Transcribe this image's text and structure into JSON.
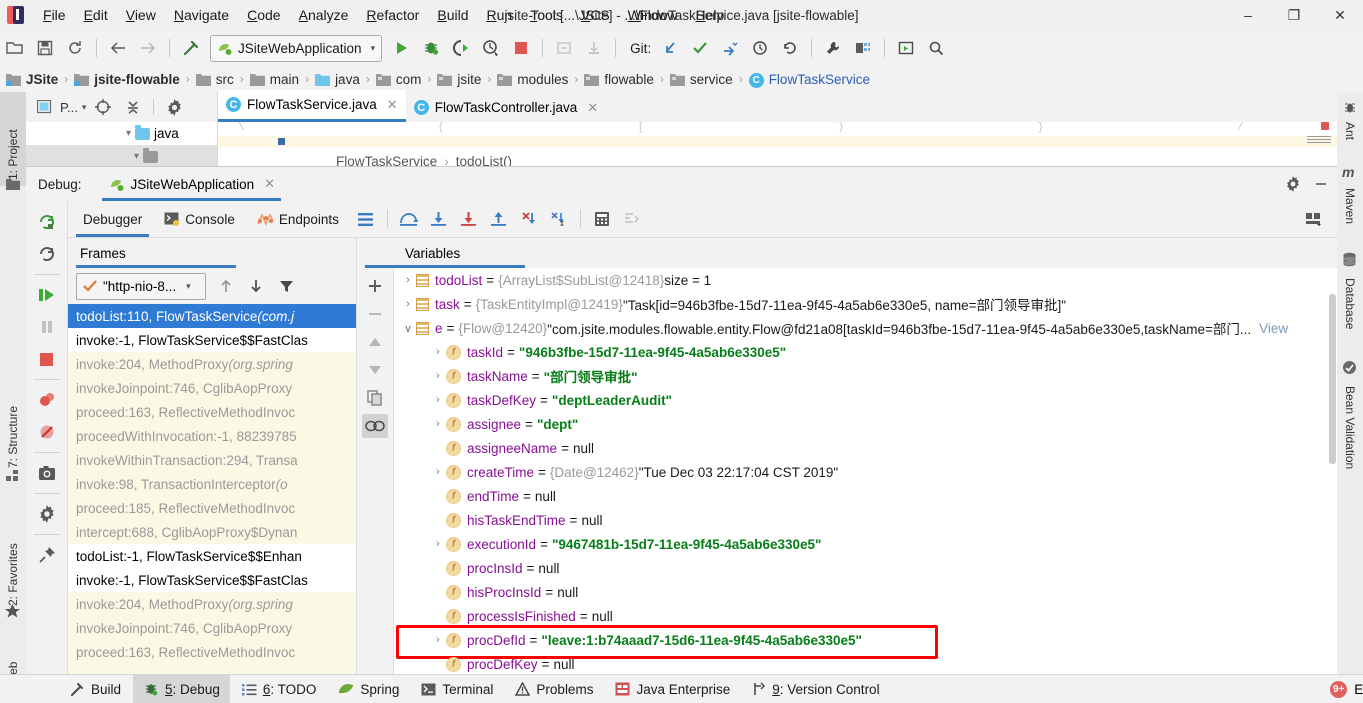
{
  "window": {
    "title": "jsite-root [...\\JSite] - ...\\FlowTaskService.java [jsite-flowable]",
    "minimize": "–",
    "maximize": "❐",
    "close": "✕"
  },
  "menu": {
    "items": [
      "File",
      "Edit",
      "View",
      "Navigate",
      "Code",
      "Analyze",
      "Refactor",
      "Build",
      "Run",
      "Tools",
      "VCS",
      "Window",
      "Help"
    ]
  },
  "toolbar": {
    "run_config": "JSiteWebApplication",
    "git_label": "Git:",
    "icons": [
      "open-folder-icon",
      "save-all-icon",
      "sync-icon",
      "back-arrow-icon",
      "forward-arrow-icon",
      "build-hammer-icon",
      "run-icon",
      "debug-icon",
      "run-with-coverage-icon",
      "profile-icon",
      "stop-icon",
      "attach-icon",
      "update-project-icon"
    ]
  },
  "breadcrumb": {
    "items": [
      {
        "label": "JSite",
        "style": "bold"
      },
      {
        "label": "jsite-flowable",
        "style": "bold"
      },
      {
        "label": "src",
        "style": "plain"
      },
      {
        "label": "main",
        "style": "plain"
      },
      {
        "label": "java",
        "style": "plain"
      },
      {
        "label": "com",
        "style": "plain"
      },
      {
        "label": "jsite",
        "style": "plain"
      },
      {
        "label": "modules",
        "style": "plain"
      },
      {
        "label": "flowable",
        "style": "plain"
      },
      {
        "label": "service",
        "style": "plain"
      },
      {
        "label": "FlowTaskService",
        "style": "class"
      }
    ],
    "separator": "›"
  },
  "left_strip": {
    "items": [
      {
        "label": "1: Project",
        "selected": true
      },
      {
        "label": "7: Structure",
        "selected": false
      },
      {
        "label": "2: Favorites",
        "selected": false
      },
      {
        "label": "Web",
        "selected": false
      }
    ]
  },
  "right_strip": {
    "items": [
      {
        "label": "Ant"
      },
      {
        "label": "Maven"
      },
      {
        "label": "Database"
      },
      {
        "label": "Bean Validation"
      }
    ]
  },
  "editor": {
    "tabs": [
      {
        "label": "FlowTaskService.java",
        "active": true
      },
      {
        "label": "FlowTaskController.java",
        "active": false
      }
    ],
    "close_glyph": "✕",
    "breadcrumb": "FlowTaskService",
    "breadcrumb_method": "todoList()",
    "breadcrumb_sep": "›",
    "tree_node": "java"
  },
  "debug_window": {
    "label": "Debug:",
    "session_tab": "JSiteWebApplication",
    "close_glyph": "✕",
    "settings_icon": "gear-icon",
    "hide_icon": "minimize-icon",
    "tabs": [
      {
        "label": "Debugger",
        "icon": "debugger-icon",
        "active": true
      },
      {
        "label": "Console",
        "icon": "console-icon",
        "active": false
      },
      {
        "label": "Endpoints",
        "icon": "endpoints-icon",
        "active": false
      }
    ],
    "toolbar_icons": [
      "layout-settings-icon",
      "step-over-icon",
      "step-into-icon",
      "force-step-into-icon",
      "step-out-icon",
      "drop-frame-icon",
      "run-to-cursor-icon",
      "evaluate-expression-icon",
      "mute-breakpoints-icon",
      "restore-layout-icon"
    ],
    "side_icons": [
      "rerun-icon",
      "restart-icon",
      "resume-program-icon",
      "pause-program-icon",
      "stop-icon",
      "view-breakpoints-icon",
      "mute-breakpoints-icon",
      "screenshot-icon",
      "settings-icon",
      "pin-tab-icon"
    ]
  },
  "frames": {
    "title": "Frames",
    "thread": "\"http-nio-8...",
    "thread_chevron": "∨",
    "tools": [
      "arrow-up-icon",
      "arrow-down-icon",
      "filter-icon"
    ],
    "rows": [
      {
        "text": "todoList:110, FlowTaskService ",
        "italic": "(com.j",
        "style": "selected"
      },
      {
        "text": "invoke:-1, FlowTaskService$$FastClas",
        "italic": "",
        "style": "white"
      },
      {
        "text": "invoke:204, MethodProxy ",
        "italic": "(org.spring",
        "style": "lib"
      },
      {
        "text": "invokeJoinpoint:746, CglibAopProxy",
        "italic": "",
        "style": "lib"
      },
      {
        "text": "proceed:163, ReflectiveMethodInvoc",
        "italic": "",
        "style": "lib"
      },
      {
        "text": "proceedWithInvocation:-1, 88239785",
        "italic": "",
        "style": "lib"
      },
      {
        "text": "invokeWithinTransaction:294, Transa",
        "italic": "",
        "style": "lib"
      },
      {
        "text": "invoke:98, TransactionInterceptor ",
        "italic": "(o",
        "style": "lib"
      },
      {
        "text": "proceed:185, ReflectiveMethodInvoc",
        "italic": "",
        "style": "lib"
      },
      {
        "text": "intercept:688, CglibAopProxy$Dynan",
        "italic": "",
        "style": "lib"
      },
      {
        "text": "todoList:-1, FlowTaskService$$Enhan",
        "italic": "",
        "style": "white"
      },
      {
        "text": "invoke:-1, FlowTaskService$$FastClas",
        "italic": "",
        "style": "white"
      },
      {
        "text": "invoke:204, MethodProxy ",
        "italic": "(org.spring",
        "style": "lib"
      },
      {
        "text": "invokeJoinpoint:746, CglibAopProxy",
        "italic": "",
        "style": "lib"
      },
      {
        "text": "proceed:163, ReflectiveMethodInvoc",
        "italic": "",
        "style": "lib"
      }
    ]
  },
  "variables": {
    "title": "Variables",
    "tool_icons": [
      "add-watch-icon",
      "remove-watch-icon",
      "move-up-icon",
      "move-down-icon",
      "copy-value-icon",
      "inspect-icon"
    ],
    "view_link": "View",
    "rows": [
      {
        "arrow": "›",
        "icon": "list",
        "indent": 0,
        "name": "todoList",
        "eq": "=",
        "ref": "{ArrayList$SubList@12418}",
        "value": "size = 1",
        "value_type": "plain"
      },
      {
        "arrow": "›",
        "icon": "list",
        "indent": 0,
        "name": "task",
        "eq": "=",
        "ref": "{TaskEntityImpl@12419}",
        "value": "\"Task[id=946b3fbe-15d7-11ea-9f45-4a5ab6e330e5, name=部门领导审批]\"",
        "value_type": "plain"
      },
      {
        "arrow": "∨",
        "icon": "list",
        "indent": 0,
        "name": "e",
        "eq": "=",
        "ref": "{Flow@12420}",
        "value": "\"com.jsite.modules.flowable.entity.Flow@fd21a08[taskId=946b3fbe-15d7-11ea-9f45-4a5ab6e330e5,taskName=部门... ",
        "value_type": "plain",
        "view": "View"
      },
      {
        "arrow": "›",
        "icon": "f",
        "indent": 1,
        "name": "taskId",
        "eq": "=",
        "ref": "",
        "value": "\"946b3fbe-15d7-11ea-9f45-4a5ab6e330e5\"",
        "value_type": "string"
      },
      {
        "arrow": "›",
        "icon": "f",
        "indent": 1,
        "name": "taskName",
        "eq": "=",
        "ref": "",
        "value": "\"部门领导审批\"",
        "value_type": "string"
      },
      {
        "arrow": "›",
        "icon": "f",
        "indent": 1,
        "name": "taskDefKey",
        "eq": "=",
        "ref": "",
        "value": "\"deptLeaderAudit\"",
        "value_type": "string"
      },
      {
        "arrow": "›",
        "icon": "f",
        "indent": 1,
        "name": "assignee",
        "eq": "=",
        "ref": "",
        "value": "\"dept\"",
        "value_type": "string"
      },
      {
        "arrow": "",
        "icon": "f",
        "indent": 1,
        "name": "assigneeName",
        "eq": "=",
        "ref": "",
        "value": "null",
        "value_type": "null"
      },
      {
        "arrow": "›",
        "icon": "f",
        "indent": 1,
        "name": "createTime",
        "eq": "=",
        "ref": "{Date@12462}",
        "value": "\"Tue Dec 03 22:17:04 CST 2019\"",
        "value_type": "plain"
      },
      {
        "arrow": "",
        "icon": "f",
        "indent": 1,
        "name": "endTime",
        "eq": "=",
        "ref": "",
        "value": "null",
        "value_type": "null"
      },
      {
        "arrow": "",
        "icon": "f",
        "indent": 1,
        "name": "hisTaskEndTime",
        "eq": "=",
        "ref": "",
        "value": "null",
        "value_type": "null"
      },
      {
        "arrow": "›",
        "icon": "f",
        "indent": 1,
        "name": "executionId",
        "eq": "=",
        "ref": "",
        "value": "\"9467481b-15d7-11ea-9f45-4a5ab6e330e5\"",
        "value_type": "string"
      },
      {
        "arrow": "",
        "icon": "f",
        "indent": 1,
        "name": "procInsId",
        "eq": "=",
        "ref": "",
        "value": "null",
        "value_type": "null"
      },
      {
        "arrow": "",
        "icon": "f",
        "indent": 1,
        "name": "hisProcInsId",
        "eq": "=",
        "ref": "",
        "value": "null",
        "value_type": "null"
      },
      {
        "arrow": "",
        "icon": "f",
        "indent": 1,
        "name": "processIsFinished",
        "eq": "=",
        "ref": "",
        "value": "null",
        "value_type": "null"
      },
      {
        "arrow": "›",
        "icon": "f",
        "indent": 1,
        "name": "procDefId",
        "eq": "=",
        "ref": "",
        "value": "\"leave:1:b74aaad7-15d6-11ea-9f45-4a5ab6e330e5\"",
        "value_type": "string",
        "highlighted": true
      },
      {
        "arrow": "",
        "icon": "f",
        "indent": 1,
        "name": "procDefKey",
        "eq": "=",
        "ref": "",
        "value": "null",
        "value_type": "null"
      }
    ]
  },
  "status_bar": {
    "items": [
      {
        "label": "Build",
        "icon": "hammer-icon",
        "selected": false,
        "mnemonic": ""
      },
      {
        "label": ": Debug",
        "icon": "debug-bug-icon",
        "selected": true,
        "mnemonic": "5"
      },
      {
        "label": ": TODO",
        "icon": "todo-list-icon",
        "selected": false,
        "mnemonic": "6"
      },
      {
        "label": "Spring",
        "icon": "spring-leaf-icon",
        "selected": false,
        "mnemonic": ""
      },
      {
        "label": "Terminal",
        "icon": "terminal-icon",
        "selected": false,
        "mnemonic": ""
      },
      {
        "label": "Problems",
        "icon": "warning-icon",
        "selected": false,
        "mnemonic": ""
      },
      {
        "label": "Java Enterprise",
        "icon": "java-enterprise-icon",
        "selected": false,
        "mnemonic": ""
      },
      {
        "label": ": Version Control",
        "icon": "version-control-icon",
        "selected": false,
        "mnemonic": "9"
      }
    ],
    "event_log": "Event Log",
    "event_badge": "9+"
  },
  "colors": {
    "accent_blue": "#3a7cc4",
    "selection_blue": "#2f7bd4",
    "string_green": "#067d17",
    "identifier_purple": "#871094",
    "highlight_red": "#ff0000",
    "library_frame_bg": "#fbf8e3"
  }
}
